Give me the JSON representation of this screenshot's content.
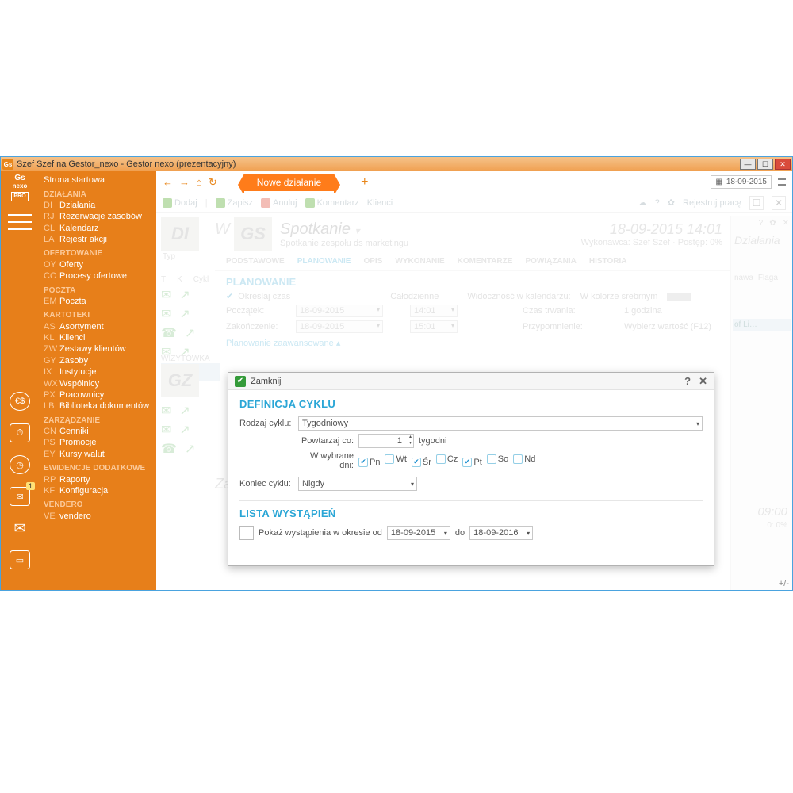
{
  "titlebar": {
    "app_badge": "Gs",
    "title": "Szef Szef na Gestor_nexo - Gestor nexo (prezentacyjny)"
  },
  "ribbon": {
    "logo_top": "Gs",
    "logo_mid": "nexo",
    "logo_bot": "PRO",
    "mail_badge": "1"
  },
  "nav": {
    "start": "Strona startowa",
    "groups": [
      {
        "head": "DZIAŁANIA",
        "items": [
          [
            "DI",
            "Działania"
          ],
          [
            "RJ",
            "Rezerwacje zasobów"
          ],
          [
            "CL",
            "Kalendarz"
          ],
          [
            "LA",
            "Rejestr akcji"
          ]
        ]
      },
      {
        "head": "OFERTOWANIE",
        "items": [
          [
            "OY",
            "Oferty"
          ],
          [
            "CO",
            "Procesy ofertowe"
          ]
        ]
      },
      {
        "head": "POCZTA",
        "items": [
          [
            "EM",
            "Poczta"
          ]
        ]
      },
      {
        "head": "KARTOTEKI",
        "items": [
          [
            "AS",
            "Asortyment"
          ],
          [
            "KL",
            "Klienci"
          ],
          [
            "ZW",
            "Zestawy klientów"
          ],
          [
            "GY",
            "Zasoby"
          ],
          [
            "IX",
            "Instytucje"
          ],
          [
            "WX",
            "Wspólnicy"
          ],
          [
            "PX",
            "Pracownicy"
          ],
          [
            "LB",
            "Biblioteka dokumentów"
          ]
        ]
      },
      {
        "head": "ZARZĄDZANIE",
        "items": [
          [
            "CN",
            "Cenniki"
          ],
          [
            "PS",
            "Promocje"
          ],
          [
            "EY",
            "Kursy walut"
          ]
        ]
      },
      {
        "head": "EWIDENCJE DODATKOWE",
        "items": [
          [
            "RP",
            "Raporty"
          ],
          [
            "KF",
            "Konfiguracja"
          ]
        ]
      },
      {
        "head": "VENDERO",
        "items": [
          [
            "VE",
            "vendero"
          ]
        ]
      }
    ]
  },
  "tabstrip": {
    "active_tab": "Nowe działanie",
    "date": "18-09-2015"
  },
  "toolbar2": {
    "add": "Dodaj",
    "save": "Zapisz",
    "cancel": "Anuluj",
    "comment": "Komentarz",
    "clients": "Klienci",
    "register": "Rejestruj pracę"
  },
  "header": {
    "left_badge": "DI",
    "gs_badge": "GS",
    "title": "Spotkanie",
    "subtitle": "Spotkanie zespołu ds marketingu",
    "datetime": "18-09-2015 14:01",
    "performer": "Wykonawca: Szef Szef · Postęp: 0%",
    "far_right_title": "Działania"
  },
  "tabs": [
    "PODSTAWOWE",
    "PLANOWANIE",
    "OPIS",
    "WYKONANIE",
    "KOMENTARZE",
    "POWIĄZANIA",
    "HISTORIA"
  ],
  "planning": {
    "section": "PLANOWANIE",
    "define_time": "Określaj czas",
    "all_day": "Całodzienne",
    "visibility_label": "Widoczność w kalendarzu:",
    "visibility_value": "W kolorze srebrnym",
    "start": "Początek:",
    "end": "Zakończenie:",
    "date1": "18-09-2015",
    "time1": "14:01",
    "date2": "18-09-2015",
    "time2": "15:01",
    "duration_label": "Czas trwania:",
    "duration_value": "1 godzina",
    "reminder_label": "Przypomnienie:",
    "reminder_value": "Wybierz wartość (F12)",
    "advanced": "Planowanie zaawansowane ▴"
  },
  "rightcol": {
    "nawa": "nawa",
    "flaga": "Flaga",
    "of_li": "of Li…",
    "time": "09:00",
    "progress": "0: 0%"
  },
  "modal": {
    "close": "Zamknij",
    "section1": "DEFINICJA CYKLU",
    "kind_label": "Rodzaj cyklu:",
    "kind_value": "Tygodniowy",
    "repeat_label": "Powtarzaj co:",
    "repeat_value": "1",
    "repeat_unit": "tygodni",
    "days_label": "W wybrane dni:",
    "days": [
      [
        "Pn",
        true
      ],
      [
        "Wt",
        false
      ],
      [
        "Śr",
        true
      ],
      [
        "Cz",
        false
      ],
      [
        "Pt",
        true
      ],
      [
        "So",
        false
      ],
      [
        "Nd",
        false
      ]
    ],
    "end_label": "Koniec cyklu:",
    "end_value": "Nigdy",
    "section2": "LISTA WYSTĄPIEŃ",
    "show_label": "Pokaż wystąpienia w okresie od",
    "from": "18-09-2015",
    "to_label": "do",
    "to": "18-09-2016"
  },
  "leftcol": {
    "DI": "DI",
    "GZ": "GZ",
    "W": "W",
    "Za": "Za",
    "wizytowka": "WIZYTÓWKA",
    "Typ": "Typ",
    "Cykl": "Cykl",
    "T": "T",
    "K": "K"
  }
}
